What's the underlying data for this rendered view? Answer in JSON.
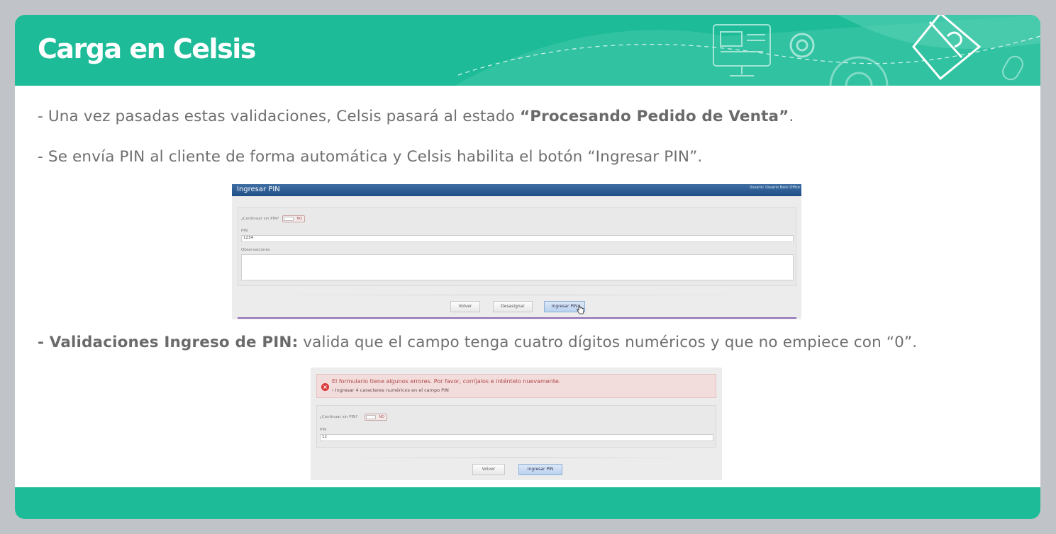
{
  "header": {
    "title": "Carga en Celsis",
    "color": "#1dbb98"
  },
  "content": {
    "line1_prefix": "- Una vez pasadas estas validaciones, Celsis pasará al estado ",
    "line1_bold": "“Procesando Pedido de Venta”",
    "line1_suffix": ".",
    "line2": "- Se envía PIN al cliente de forma automática y Celsis habilita el botón “Ingresar PIN”.",
    "line3_bold": "- Validaciones Ingreso de PIN:",
    "line3_rest": " valida que el campo tenga cuatro dígitos numéricos y que no empiece con “0”."
  },
  "screenshot1": {
    "window_title": "Ingresar PIN",
    "user_label": "Usuario: Usuario Back Office",
    "continue_label": "¿Continuar sin PIN?",
    "toggle_value": "NO",
    "pin_label": "PIN",
    "pin_value": "1234",
    "obs_label": "Observaciones",
    "btn_back": "Volver",
    "btn_unassign": "Desasignar",
    "btn_enter_pin": "Ingresar PIN"
  },
  "screenshot2": {
    "error_message": "El formulario tiene algunos errores. Por favor, corríjalos e inténtelo nuevamente.",
    "error_item": "Ingresar 4 caracteres numéricos en el campo PIN",
    "continue_label": "¿Continuar sin PIN?",
    "toggle_value": "NO",
    "pin_label": "PIN",
    "pin_value": "12",
    "btn_back": "Volver",
    "btn_enter_pin": "Ingresar PIN"
  }
}
